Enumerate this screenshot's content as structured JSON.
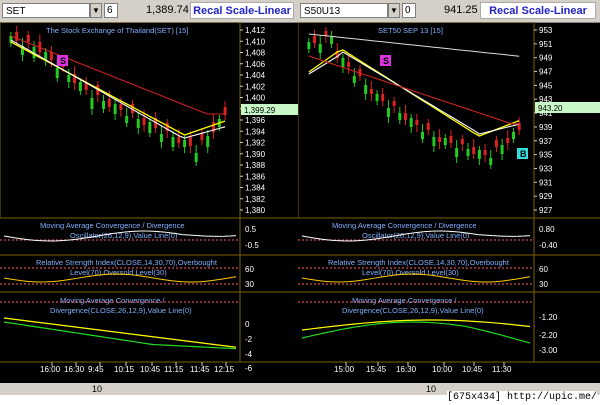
{
  "left": {
    "symbol": "SET",
    "period": "6",
    "last_price": "1,389.74",
    "recal_label": "Recal Scale-Linear",
    "main_title": "The Stock Exchange of Thailand(SET) [15]",
    "price_ticks": [
      "1,412",
      "1,410",
      "1,408",
      "1,406",
      "1,404",
      "1,402",
      "1,400",
      "1,398",
      "1,396",
      "1,394",
      "1,392",
      "1,390",
      "1,388",
      "1,386",
      "1,384",
      "1,382",
      "1,380"
    ],
    "price_highlight": "1,399.29",
    "signal_label": "S",
    "macd_title_1": "Moving Average Convergence / Divergence",
    "macd_title_2": "Oscillator(26,12,9),Value Line(0)",
    "macd_ticks": [
      "0.5",
      "-0.5"
    ],
    "rsi_title_1": "Relative Strength Index(CLOSE,14,30,70),Overbought",
    "rsi_title_2": "Level(70),Oversold Level(30)",
    "rsi_ticks": [
      "60",
      "30"
    ],
    "macd2_title_1": "Moving Average Convergence /",
    "macd2_title_2": "Divergence(CLOSE,26,12,9),Value Line(0)",
    "macd2_ticks": [
      "0",
      "-2",
      "-4",
      "-6"
    ],
    "time_ticks": [
      "16:00",
      "16:30",
      "9:45",
      "10:15",
      "10:45",
      "11:15",
      "11:45",
      "12:15"
    ],
    "status_value": "10"
  },
  "right": {
    "symbol": "S50U13",
    "period": "0",
    "last_price": "941.25",
    "recal_label": "Recal Scale-Linear",
    "main_title": "SET50 SEP 13   [15]",
    "price_ticks": [
      "953",
      "951",
      "949",
      "947",
      "945",
      "943",
      "941",
      "939",
      "937",
      "935",
      "933",
      "931",
      "929",
      "927"
    ],
    "price_highlight": "943.20",
    "signal_label_s": "S",
    "signal_label_b": "B",
    "macd_title_1": "Moving Average Convergence / Divergence",
    "macd_title_2": "Oscillator(26,12,9),Value Line(0)",
    "macd_ticks": [
      "0.80",
      "-0.40"
    ],
    "rsi_title_1": "Relative Strength Index(CLOSE,14,30,70),Overbought",
    "rsi_title_2": "Level(70),Oversold Level(30)",
    "rsi_ticks": [
      "60",
      "30"
    ],
    "macd2_title_1": "Moving Average Convergence /",
    "macd2_title_2": "Divergence(CLOSE,26,12,9),Value Line(0)",
    "macd2_ticks": [
      "-1.20",
      "-2.20",
      "-3.00"
    ],
    "time_ticks": [
      "15:00",
      "15:45",
      "16:30",
      "10:00",
      "10:45",
      "11:30"
    ],
    "status_value": "10"
  },
  "watermark": "[675x434] http://upic.me/",
  "colors": {
    "up": "#22cc22",
    "down": "#dd2222",
    "ma_yellow": "#ffff00",
    "ma_red": "#cc2222",
    "ma_white": "#ffffff",
    "grid": "#806000",
    "text": "#ffffff",
    "recal": "#2323c8",
    "sell_box": "#dd33dd",
    "buy_box": "#33dddd"
  }
}
